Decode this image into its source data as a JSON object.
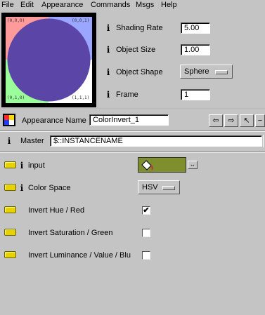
{
  "menubar": {
    "items": [
      "File",
      "Edit",
      "Appearance",
      "Commands",
      "Msgs",
      "Help"
    ]
  },
  "preview": {
    "sphere_color": "#5b46a8",
    "corner_labels": [
      "(0,0,0)",
      "(0,0,1)",
      "(0,1,0)",
      "(1,1,1)"
    ]
  },
  "render_params": {
    "shading_rate": {
      "label": "Shading Rate",
      "value": "5.00"
    },
    "object_size": {
      "label": "Object Size",
      "value": "1.00"
    },
    "object_shape": {
      "label": "Object Shape",
      "value": "Sphere"
    },
    "frame": {
      "label": "Frame",
      "value": "1"
    }
  },
  "appearance": {
    "name_label": "Appearance Name",
    "name_value": "ColorInvert_1",
    "master_label": "Master",
    "master_value": "$::INSTANCENAME"
  },
  "params": {
    "input": {
      "label": "input",
      "swatch_color": "#7f8f2e"
    },
    "color_space": {
      "label": "Color Space",
      "value": "HSV"
    },
    "invert_hue": {
      "label": "Invert Hue / Red",
      "checked": true,
      "mark": "✔"
    },
    "invert_saturation": {
      "label": "Invert Saturation / Green",
      "checked": false
    },
    "invert_luminance": {
      "label": "Invert Luminance / Value / Blu",
      "checked": false
    }
  }
}
